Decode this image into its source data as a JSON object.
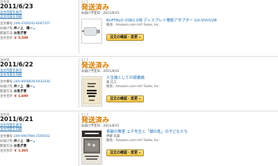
{
  "labels": {
    "order_date_label": "注文日",
    "view_details": "注文内容を表示",
    "print_receipt": "注文内容を印刷",
    "order_number_label": "注文番号：",
    "recipient_label": "お届け先：",
    "shipping_label": "配送方法：",
    "total_label": "注文合計：",
    "shipping_method": "お急ぎ便",
    "item_count": "1 / 1",
    "status": "発送済み",
    "ship_date_prefix": "お届け予定日：",
    "seller_prefix": "販売：",
    "manage_button": "注文の確認・変更",
    "caret": "▾"
  },
  "orders": [
    {
      "date": "2011/6/23",
      "order_number": "249-4330542-8287257",
      "recipient": "井ノ上　陽一",
      "total": "￥ 5,509",
      "ship_date": "2011/6/23",
      "item": {
        "title": "BUFFALO USB2.0用 ディスプレイ増設アダプター GX-DVI/U2B",
        "author": "",
        "seller": "Amazon.com Int'l Sales, Inc."
      }
    },
    {
      "date": "2011/6/22",
      "order_number": "249-8958828-6422430",
      "recipient": "井ノ上　陽一",
      "total": "￥ 1,680",
      "ship_date": "2011/6/22",
      "item": {
        "title": "人生論としての読書論",
        "author": "森 信三",
        "seller": "Amazon.com Int'l Sales, Inc."
      }
    },
    {
      "date": "2011/6/21",
      "order_number": "249-6907994-2505652",
      "recipient": "井ノ上　陽一",
      "total": "￥ 1,365",
      "ship_date": "2011/6/21",
      "item": {
        "title": "奇跡の教室 エチ先生と「銀の匙」の子どもたち",
        "author": "伊藤 氏貴",
        "seller": "Amazon.com Int'l Sales, Inc."
      }
    }
  ]
}
